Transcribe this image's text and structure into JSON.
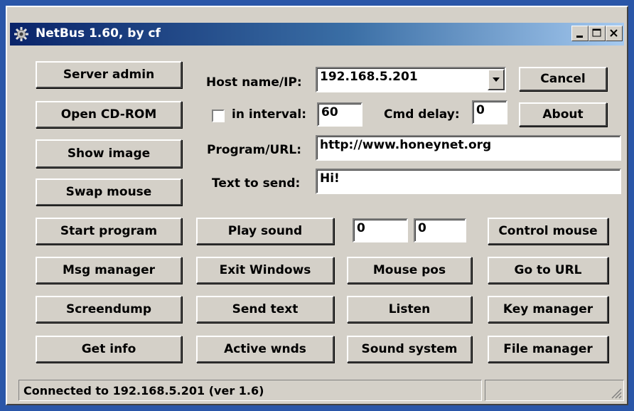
{
  "window": {
    "title": "NetBus 1.60, by cf",
    "icon": "gear-icon",
    "controls": [
      "minimize-icon",
      "maximize-icon",
      "close-icon"
    ]
  },
  "buttons": {
    "server_admin": "Server admin",
    "open_cdrom": "Open CD-ROM",
    "show_image": "Show image",
    "swap_mouse": "Swap mouse",
    "cancel": "Cancel",
    "about": "About",
    "start_program": "Start program",
    "play_sound": "Play sound",
    "control_mouse": "Control mouse",
    "msg_manager": "Msg manager",
    "exit_windows": "Exit Windows",
    "mouse_pos": "Mouse pos",
    "go_to_url": "Go to URL",
    "screendump": "Screendump",
    "send_text": "Send text",
    "listen": "Listen",
    "key_manager": "Key manager",
    "get_info": "Get info",
    "active_wnds": "Active wnds",
    "sound_system": "Sound system",
    "file_manager": "File manager"
  },
  "form": {
    "host_label": "Host name/IP:",
    "host_value": "192.168.5.201",
    "interval_label": "in interval:",
    "interval_checked": false,
    "interval_value": "60",
    "cmd_delay_label": "Cmd delay:",
    "cmd_delay_value": "0",
    "program_label": "Program/URL:",
    "program_value": "http://www.honeynet.org",
    "text_label": "Text to send:",
    "text_value": "Hi!",
    "mouse_x": "0",
    "mouse_y": "0"
  },
  "status": {
    "text": "Connected to 192.168.5.201 (ver 1.6)"
  },
  "colors": {
    "face": "#d4d0c8",
    "title_start": "#0a246a",
    "title_end": "#a6caf0",
    "desktop": "#2a56a8"
  }
}
